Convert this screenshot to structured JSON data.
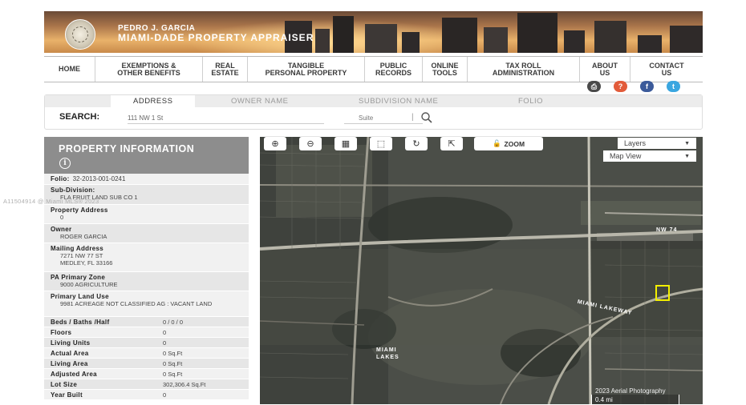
{
  "header": {
    "brand_line1": "PEDRO J. GARCIA",
    "brand_line2": "MIAMI-DADE PROPERTY APPRAISER"
  },
  "nav": [
    {
      "label": "HOME"
    },
    {
      "label": "EXEMPTIONS &\nOTHER BENEFITS"
    },
    {
      "label": "REAL\nESTATE"
    },
    {
      "label": "TANGIBLE\nPERSONAL PROPERTY"
    },
    {
      "label": "PUBLIC\nRECORDS"
    },
    {
      "label": "ONLINE\nTOOLS"
    },
    {
      "label": "TAX ROLL\nADMINISTRATION"
    },
    {
      "label": "ABOUT\nUS"
    },
    {
      "label": "CONTACT\nUS"
    }
  ],
  "social_icons": [
    {
      "name": "print-icon",
      "glyph": "⎙",
      "color": "#4a4a4a"
    },
    {
      "name": "help-icon",
      "glyph": "?",
      "color": "#e25b3a"
    },
    {
      "name": "facebook-icon",
      "glyph": "f",
      "color": "#3b5a9a"
    },
    {
      "name": "twitter-icon",
      "glyph": "t",
      "color": "#3aa6e0"
    }
  ],
  "search": {
    "tabs": [
      "ADDRESS",
      "OWNER NAME",
      "SUBDIVISION NAME",
      "FOLIO"
    ],
    "active_tab": "ADDRESS",
    "label": "SEARCH:",
    "address_value": "111 NW 1 St",
    "suite_placeholder": "Suite"
  },
  "property": {
    "title": "PROPERTY INFORMATION",
    "info_glyph": "i",
    "folio": {
      "label": "Folio:",
      "value": "32-2013-001-0241"
    },
    "subdivision": {
      "label": "Sub-Division:",
      "value": "FLA FRUIT LAND SUB CO 1"
    },
    "property_address": {
      "label": "Property Address",
      "value": "0"
    },
    "owner": {
      "label": "Owner",
      "value": "ROGER GARCIA"
    },
    "mailing_address": {
      "label": "Mailing Address",
      "line1": "7271 NW 77 ST",
      "line2": "MEDLEY, FL 33166"
    },
    "pa_zone": {
      "label": "PA Primary Zone",
      "value": "9000 AGRICULTURE"
    },
    "land_use": {
      "label": "Primary Land Use",
      "value": "9981 ACREAGE NOT CLASSIFIED AG : VACANT LAND"
    },
    "beds": {
      "label": "Beds / Baths /Half",
      "value": "0 / 0 / 0"
    },
    "floors": {
      "label": "Floors",
      "value": "0"
    },
    "living_units": {
      "label": "Living Units",
      "value": "0"
    },
    "actual_area": {
      "label": "Actual Area",
      "value": "0 Sq.Ft"
    },
    "living_area": {
      "label": "Living Area",
      "value": "0 Sq.Ft"
    },
    "adjusted_area": {
      "label": "Adjusted Area",
      "value": "0 Sq.Ft"
    },
    "lot_size": {
      "label": "Lot Size",
      "value": "302,306.4 Sq.Ft"
    },
    "year_built": {
      "label": "Year Built",
      "value": "0"
    }
  },
  "watermark": "A11504914 @ Miami MLS® 2023",
  "map": {
    "zoom_label": "ZOOM",
    "layers_label": "Layers",
    "view_label": "Map View",
    "attribution": "2023 Aerial Photography",
    "scale": "0.4 mi",
    "labels": [
      "NW 74",
      "MIAMI LAKEWAY",
      "MIAMI LAKES"
    ]
  }
}
